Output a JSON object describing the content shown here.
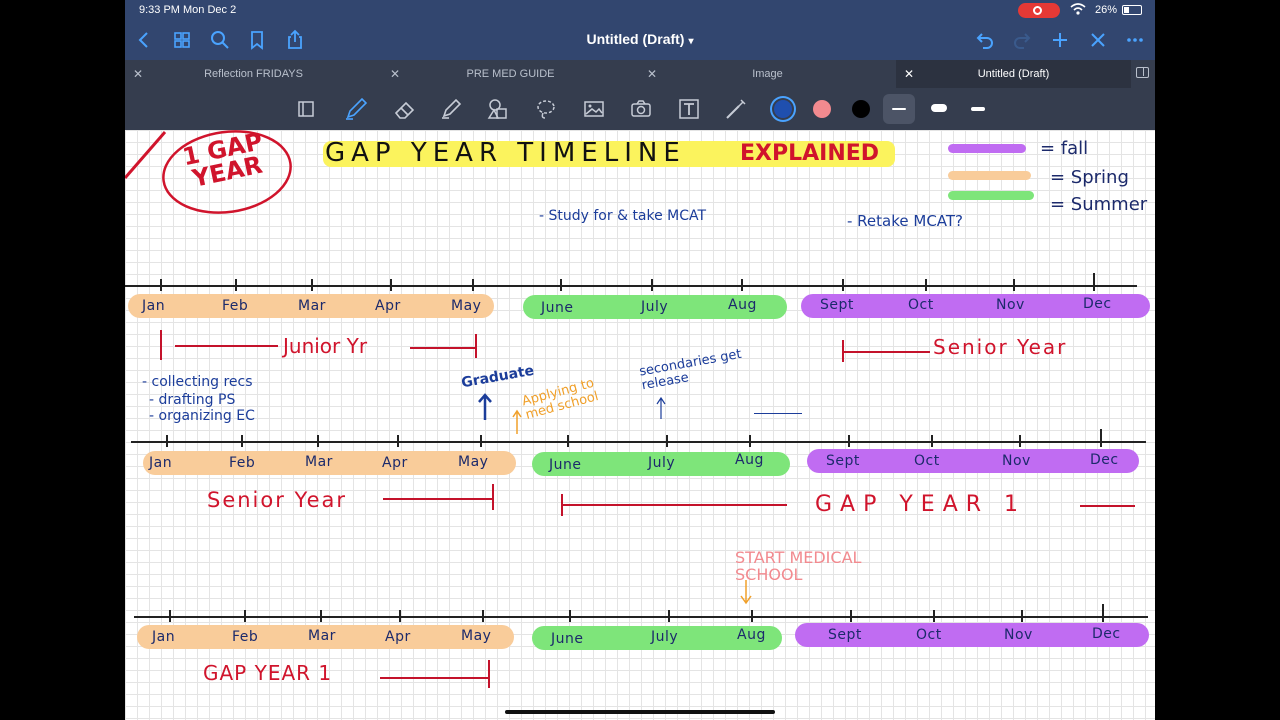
{
  "status_bar": {
    "time": "9:33 PM  Mon Dec 2",
    "battery": "26%"
  },
  "nav": {
    "title": "Untitled (Draft)",
    "left_icons": [
      "back-chevron-icon",
      "grid-icon",
      "search-icon",
      "bookmark-icon",
      "share-icon"
    ],
    "right_icons": [
      "undo-icon",
      "redo-icon",
      "plus-icon",
      "close-icon",
      "more-icon"
    ]
  },
  "tabs": [
    {
      "label": "Reflection FRIDAYS",
      "active": false
    },
    {
      "label": "PRE MED GUIDE",
      "active": false
    },
    {
      "label": "Image",
      "active": false
    },
    {
      "label": "Untitled (Draft)",
      "active": true
    }
  ],
  "toolbar": {
    "tools": [
      "page-icon",
      "pen-icon",
      "eraser-icon",
      "highlighter-icon",
      "shapes-icon",
      "lasso-icon",
      "image-icon",
      "camera-icon",
      "text-icon",
      "laser-icon"
    ],
    "colors": [
      "#1f4fae",
      "#f28a8f",
      "#000000"
    ],
    "selected_color": "#1f4fae"
  },
  "canvas": {
    "stamp": "1 GAP YEAR",
    "title_main": "GAP YEAR TIMELINE",
    "title_accent": "EXPLAINED",
    "legend": [
      {
        "label": "= fall",
        "color": "#c06cf2"
      },
      {
        "label": "= Spring",
        "color": "#f9cc9a"
      },
      {
        "label": "= Summer",
        "color": "#7ee57a"
      }
    ],
    "note_mcat": "- Study for & take MCAT",
    "note_retake": "- Retake MCAT?",
    "months_spring": [
      "Jan",
      "Feb",
      "Mar",
      "Apr",
      "May"
    ],
    "months_summer": [
      "June",
      "July",
      "Aug"
    ],
    "months_fall": [
      "Sept",
      "Oct",
      "Nov",
      "Dec"
    ],
    "row1_left": "Junior Yr",
    "row1_right": "Senior Year",
    "notes_list": [
      "- collecting recs",
      "- drafting PS",
      "- organizing EC"
    ],
    "graduate": "Graduate",
    "applying": "Applying to med school",
    "secondaries": "secondaries get release",
    "row2_left": "Senior Year",
    "row2_right": "GAP YEAR 1",
    "start_med": "START MEDICAL SCHOOL",
    "row3_left": "GAP YEAR 1"
  }
}
